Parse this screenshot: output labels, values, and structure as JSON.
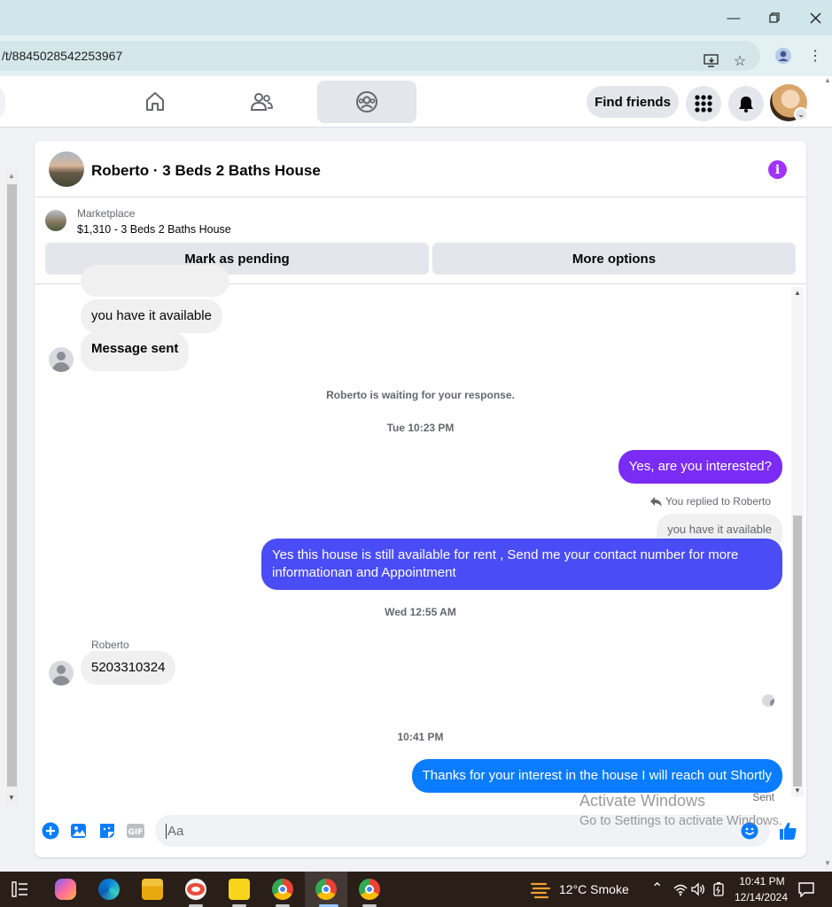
{
  "browser": {
    "url": "/t/8845028542253967",
    "window_controls": [
      "minimize",
      "restore",
      "close"
    ]
  },
  "fbnav": {
    "find_friends": "Find friends"
  },
  "chat": {
    "title": "Roberto · 3 Beds 2 Baths House",
    "marketplace_label": "Marketplace",
    "listing": "$1,310 - 3 Beds 2 Baths House",
    "mark_pending": "Mark as pending",
    "more_options": "More options",
    "messages": {
      "m1": "you have it available",
      "m2": "Message sent",
      "waiting": "Roberto is waiting for your response.",
      "ts1": "Tue 10:23 PM",
      "m3": "Yes, are you interested?",
      "replied": "You replied to Roberto",
      "quote": "you have it available",
      "m4": "Yes this house is still available for rent , Send me your contact number for more informationan and Appointment",
      "ts2": "Wed 12:55 AM",
      "sender": "Roberto",
      "m5": "5203310324",
      "ts3": "10:41 PM",
      "m6": "Thanks for your interest in the house I will reach out Shortly",
      "status": "Sent"
    },
    "composer_placeholder": "Aa",
    "colors": {
      "purple": "#7b2cf4",
      "blue_violet": "#4a4cf5",
      "blue": "#0a7cff"
    }
  },
  "watermark": {
    "line1": "Activate Windows",
    "line2": "Go to Settings to activate Windows."
  },
  "taskbar": {
    "weather": "12°C  Smoke",
    "time": "10:41 PM",
    "date": "12/14/2024"
  }
}
